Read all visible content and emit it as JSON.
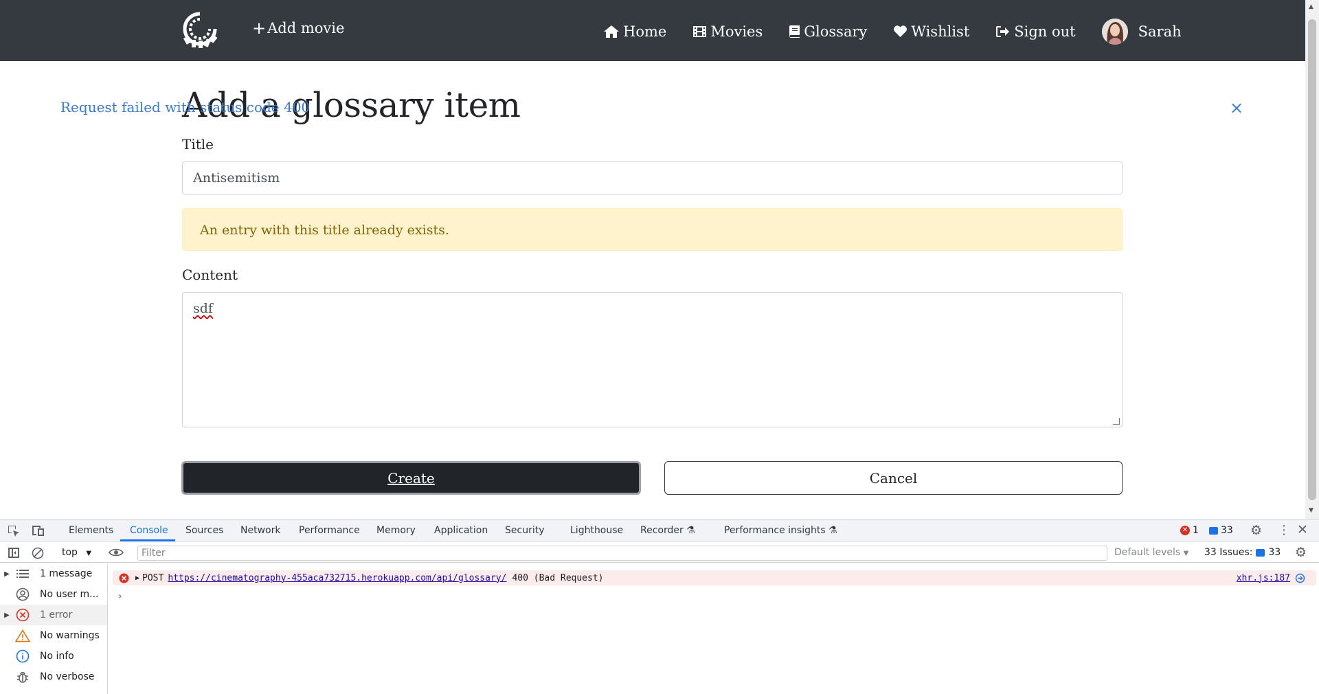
{
  "navbar": {
    "add_movie": "Add movie",
    "links": [
      {
        "label": "Home",
        "icon": "home-icon"
      },
      {
        "label": "Movies",
        "icon": "film-icon"
      },
      {
        "label": "Glossary",
        "icon": "book-icon"
      },
      {
        "label": "Wishlist",
        "icon": "heart-icon"
      },
      {
        "label": "Sign out",
        "icon": "sign-out-icon"
      }
    ],
    "user_name": "Sarah"
  },
  "alert": {
    "message": "Request failed with status code 400",
    "close": "×"
  },
  "form": {
    "title": "Add a glossary item",
    "title_label": "Title",
    "title_value": "Antisemitism",
    "warning": "An entry with this title already exists.",
    "content_label": "Content",
    "content_value": "sdf",
    "create_label": "Create",
    "cancel_label": "Cancel"
  },
  "devtools": {
    "tabs": [
      "Elements",
      "Console",
      "Sources",
      "Network",
      "Performance",
      "Memory",
      "Application",
      "Security",
      "Lighthouse",
      "Recorder",
      "Performance insights"
    ],
    "active_tab": "Console",
    "error_count": "1",
    "message_count": "33",
    "context": "top",
    "filter_placeholder": "Filter",
    "levels": "Default levels",
    "issues_label": "33 Issues:",
    "issues_count": "33",
    "sidebar": [
      {
        "label": "1 message",
        "icon": "list-icon"
      },
      {
        "label": "No user m...",
        "icon": "user-icon"
      },
      {
        "label": "1 error",
        "icon": "error-icon"
      },
      {
        "label": "No warnings",
        "icon": "warning-icon"
      },
      {
        "label": "No info",
        "icon": "info-icon"
      },
      {
        "label": "No verbose",
        "icon": "bug-icon"
      }
    ],
    "console_entry": {
      "method": "POST",
      "url": "https://cinematography-455aca732715.herokuapp.com/api/glossary/",
      "status": "400 (Bad Request)",
      "source": "xhr.js:187"
    },
    "prompt": "›"
  },
  "colors": {
    "navbar_bg": "#343a40",
    "link_blue": "#3a7bd5",
    "warning_bg": "#fff3cd",
    "devtools_accent": "#1a73e8"
  }
}
